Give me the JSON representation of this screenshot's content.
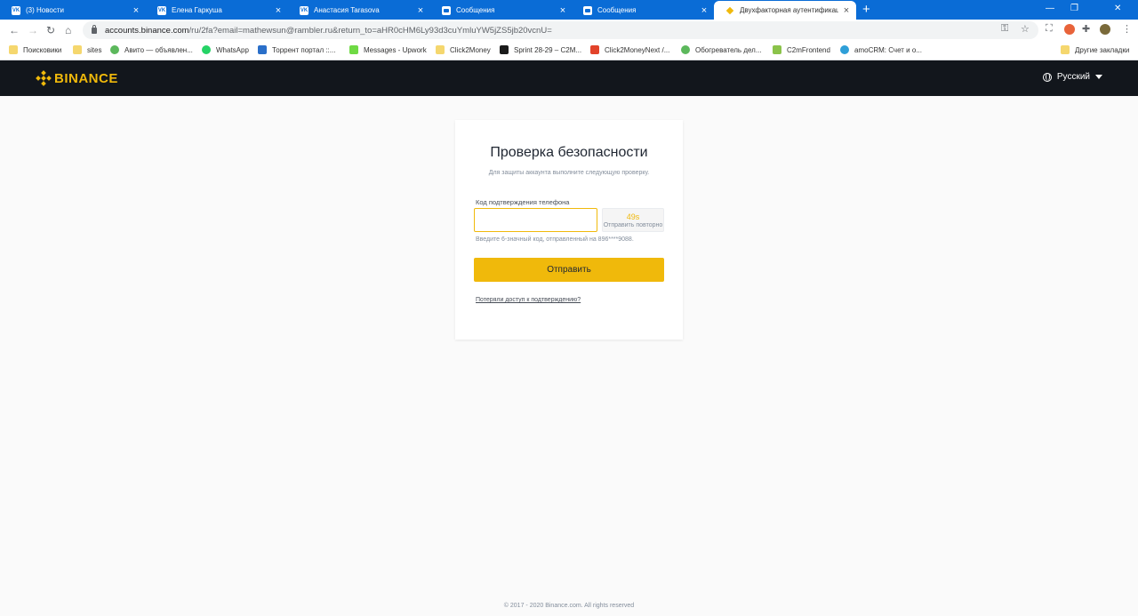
{
  "browser": {
    "tabs": [
      {
        "title": "(3) Новости",
        "favicon": "vk-icon"
      },
      {
        "title": "Елена Гаркуша",
        "favicon": "vk-icon"
      },
      {
        "title": "Анастасия Tarasova",
        "favicon": "vk-icon"
      },
      {
        "title": "Сообщения",
        "favicon": "messages-icon"
      },
      {
        "title": "Сообщения",
        "favicon": "messages-icon"
      },
      {
        "title": "Двухфакторная аутентификация",
        "favicon": "binance-icon",
        "active": true
      }
    ],
    "new_tab_label": "+",
    "url_host": "accounts.binance.com",
    "url_path": "/ru/2fa?email=mathewsun@rambler.ru&return_to=aHR0cHM6Ly93d3cuYmluYW5jZS5jb20vcnU=",
    "bookmarks": [
      {
        "label": "Поисковики",
        "icon": "folder-icon"
      },
      {
        "label": "sites",
        "icon": "folder-icon"
      },
      {
        "label": "Авито — объявлен...",
        "icon": "avito-icon"
      },
      {
        "label": "WhatsApp",
        "icon": "whatsapp-icon"
      },
      {
        "label": "Торрент портал ::...",
        "icon": "torrent-icon"
      },
      {
        "label": "Messages - Upwork",
        "icon": "upwork-icon"
      },
      {
        "label": "Click2Money",
        "icon": "folder-icon"
      },
      {
        "label": "Sprint 28-29 – C2M...",
        "icon": "youtrack-icon"
      },
      {
        "label": "Click2MoneyNext /...",
        "icon": "gitlab-icon"
      },
      {
        "label": "Обогреватель дел...",
        "icon": "avito-icon"
      },
      {
        "label": "C2mFrontend",
        "icon": "c2m-icon"
      },
      {
        "label": "amoCRM: Счет и о...",
        "icon": "amocrm-icon"
      }
    ],
    "other_bookmarks": "Другие закладки",
    "colors": {
      "tabstrip": "#0a6cd6"
    }
  },
  "header": {
    "logo_text": "BINANCE",
    "language": "Русский",
    "colors": {
      "bg": "#12161c",
      "brand": "#f0b90b"
    }
  },
  "card": {
    "title": "Проверка безопасности",
    "subtitle": "Для защиты аккаунта выполните следующую проверку.",
    "field_label": "Код подтверждения телефона",
    "code_value": "",
    "resend_timer": "49s",
    "resend_label": "Отправить повторно",
    "hint": "Введите 6-значный код, отправленный на 896****9088.",
    "submit_label": "Отправить",
    "lost_access_link": "Потеряли доступ к подтверждению?"
  },
  "footer": {
    "copyright": "© 2017 - 2020 Binance.com. All rights reserved"
  }
}
